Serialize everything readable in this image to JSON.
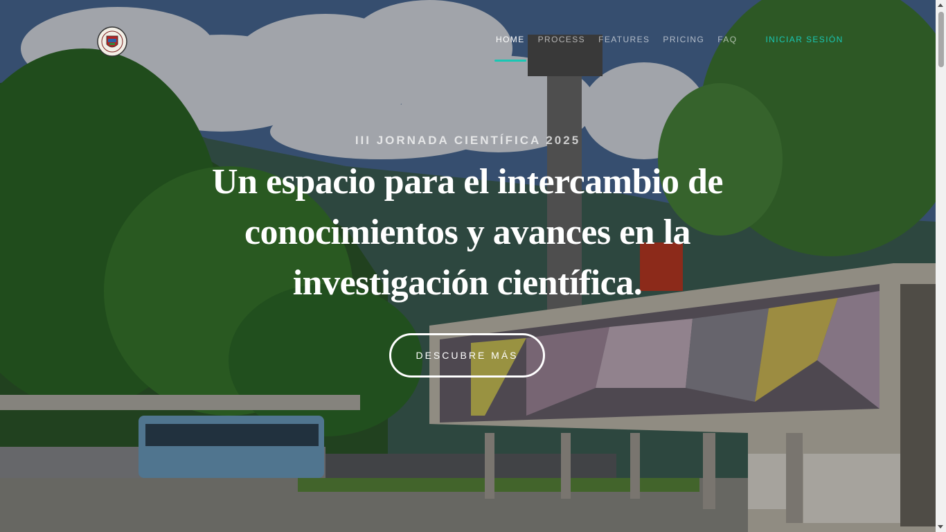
{
  "header": {
    "nav": [
      {
        "label": "HOME",
        "active": true
      },
      {
        "label": "PROCESS",
        "active": false
      },
      {
        "label": "FEATURES",
        "active": false
      },
      {
        "label": "PRICING",
        "active": false
      },
      {
        "label": "FAQ",
        "active": false
      }
    ],
    "login_label": "INICIAR SESIÓN"
  },
  "hero": {
    "eyebrow": "III JORNADA CIENTÍFICA 2025",
    "headline": "Un espacio para el intercambio de conocimientos y avances en la investigación científica.",
    "cta_label": "DESCUBRE MÁS"
  },
  "colors": {
    "accent": "#19c7b4",
    "text": "#ffffff"
  }
}
